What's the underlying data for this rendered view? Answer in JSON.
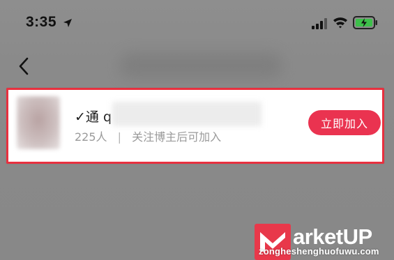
{
  "status_bar": {
    "time": "3:35"
  },
  "nav": {
    "title": ""
  },
  "group_card": {
    "name": "✓通 q",
    "member_count": "225人",
    "separator": "|",
    "requirement": "关注博主后可加入",
    "join_label": "立即加入"
  },
  "watermark": {
    "brand": "arketUP",
    "site": "zongheshenghuofuwu.com"
  },
  "colors": {
    "accent": "#ea3350",
    "highlight_border": "#e8303f",
    "overlay": "#898989"
  }
}
